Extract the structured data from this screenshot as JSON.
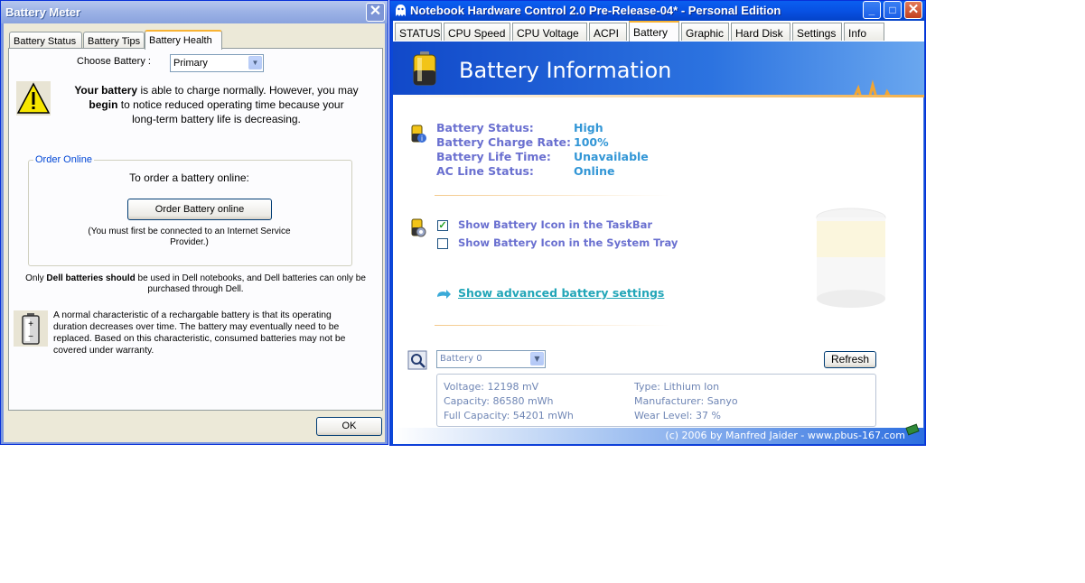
{
  "battery_meter": {
    "title": "Battery Meter",
    "close_glyph": "✕",
    "tabs": [
      {
        "label": "Battery Status",
        "active": false
      },
      {
        "label": "Battery Tips",
        "active": false
      },
      {
        "label": "Battery Health",
        "active": true
      }
    ],
    "choose_battery_label": "Choose Battery :",
    "choose_battery_value": "Primary",
    "warning": {
      "icon": "warning-icon",
      "line1_prefix": "Your battery",
      "line1_suffix": " is able to charge normally. However, you may",
      "line2_prefix": "begin",
      "line2_suffix": " to notice reduced operating time because your",
      "line3": "long-term battery life is decreasing."
    },
    "order_online": {
      "group_label": "Order Online",
      "heading": "To order a battery online:",
      "button_label": "Order Battery online",
      "note_line1": "(You must first be connected to an Internet Service",
      "note_line2": "Provider.)"
    },
    "dell_note": {
      "prefix": "Only ",
      "bold": "Dell batteries should",
      "suffix": " be used in Dell notebooks, and Dell batteries can only be",
      "line2": "purchased through Dell."
    },
    "characteristic": {
      "icon": "battery-icon",
      "lines": [
        "A normal characteristic of a rechargable battery is that its operating",
        "duration decreases over time.  The battery may eventually need to be",
        "replaced.  Based on this characteristic, consumed batteries may not be",
        "covered under warranty."
      ]
    },
    "ok_label": "OK"
  },
  "nhc": {
    "title": "Notebook Hardware Control 2.0 Pre-Release-04*  -  Personal Edition",
    "tabs": [
      {
        "label": "STATUS",
        "active": false
      },
      {
        "label": "CPU Speed",
        "active": false
      },
      {
        "label": "CPU Voltage",
        "active": false
      },
      {
        "label": "ACPI",
        "active": false
      },
      {
        "label": "Battery",
        "active": true
      },
      {
        "label": "Graphic",
        "active": false
      },
      {
        "label": "Hard Disk",
        "active": false
      },
      {
        "label": "Settings",
        "active": false
      },
      {
        "label": "Info",
        "active": false
      }
    ],
    "banner_title": "Battery Information",
    "status": [
      {
        "label": "Battery Status:",
        "value": "High"
      },
      {
        "label": "Battery Charge Rate:",
        "value": "100%"
      },
      {
        "label": "Battery Life Time:",
        "value": "Unavailable"
      },
      {
        "label": "AC Line Status:",
        "value": "Online"
      }
    ],
    "options": [
      {
        "label": "Show Battery Icon in the TaskBar",
        "checked": true
      },
      {
        "label": "Show Battery Icon in the System Tray",
        "checked": false
      }
    ],
    "advanced_link": "Show advanced battery settings",
    "battery_select": "Battery 0",
    "refresh_label": "Refresh",
    "details": {
      "voltage": "Voltage:  12198 mV",
      "capacity": "Capacity:  86580 mWh",
      "full_capacity": "Full Capacity:  54201 mWh",
      "type": "Type:  Lithium Ion",
      "manufacturer": "Manufacturer:  Sanyo",
      "wear_level": "Wear Level:  37 %"
    },
    "footer": "(c) 2006 by Manfred Jaider  -  www.pbus-167.com"
  }
}
